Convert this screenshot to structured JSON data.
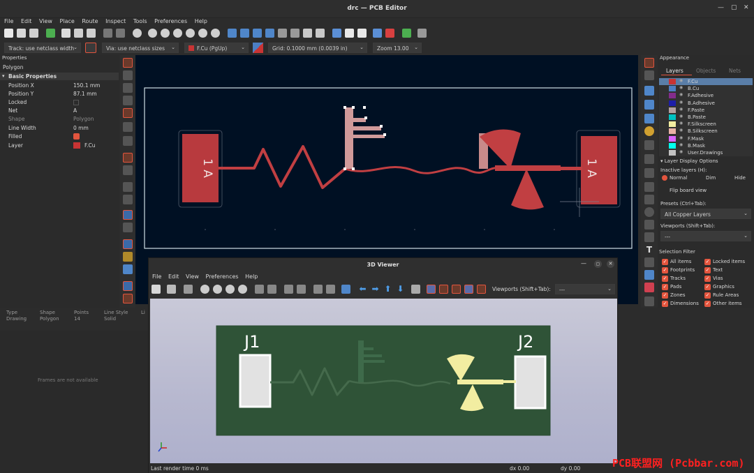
{
  "window": {
    "title": "drc — PCB Editor",
    "controls": [
      "—",
      "▢",
      "✕"
    ]
  },
  "menu": [
    "File",
    "Edit",
    "View",
    "Place",
    "Route",
    "Inspect",
    "Tools",
    "Preferences",
    "Help"
  ],
  "toolbar2": {
    "track": "Track: use netclass width",
    "via": "Via: use netclass sizes",
    "layer": "F.Cu (PgUp)",
    "grid": "Grid: 0.1000 mm (0.0039 in)",
    "zoom": "Zoom 13.00"
  },
  "properties": {
    "header": "Properties",
    "type": "Polygon",
    "section": "Basic Properties",
    "rows": [
      {
        "key": "Position X",
        "value": "150.1 mm"
      },
      {
        "key": "Position Y",
        "value": "87.1 mm"
      },
      {
        "key": "Locked",
        "value": ""
      },
      {
        "key": "Net",
        "value": "A"
      },
      {
        "key": "Shape",
        "value": "Polygon"
      },
      {
        "key": "Line Width",
        "value": "0 mm"
      },
      {
        "key": "Filled",
        "value": ""
      },
      {
        "key": "Layer",
        "value": "F.Cu"
      }
    ]
  },
  "canvas": {
    "pad_left_label": "1 A",
    "pad_right_label": "1 A"
  },
  "appearance": {
    "header": "Appearance",
    "tabs": [
      "Layers",
      "Objects",
      "Nets"
    ],
    "layers": [
      {
        "name": "F.Cu",
        "color": "#c83434"
      },
      {
        "name": "B.Cu",
        "color": "#4d7fc4"
      },
      {
        "name": "F.Adhesive",
        "color": "#842c8c"
      },
      {
        "name": "B.Adhesive",
        "color": "#1e1ea8"
      },
      {
        "name": "F.Paste",
        "color": "#b4a0a0"
      },
      {
        "name": "B.Paste",
        "color": "#00c2c2"
      },
      {
        "name": "F.Silkscreen",
        "color": "#f2eda1"
      },
      {
        "name": "B.Silkscreen",
        "color": "#e8b2a7"
      },
      {
        "name": "F.Mask",
        "color": "#d864ff"
      },
      {
        "name": "B.Mask",
        "color": "#02ffee"
      },
      {
        "name": "User.Drawings",
        "color": "#c2c2c2"
      }
    ],
    "display_options": "Layer Display Options",
    "inactive_label": "Inactive layers (H):",
    "inactive_options": [
      "Normal",
      "Dim",
      "Hide"
    ],
    "flip": "Flip board view",
    "presets_label": "Presets (Ctrl+Tab):",
    "presets_value": "All Copper Layers",
    "viewports_label": "Viewports (Shift+Tab):",
    "viewports_value": "---",
    "selection_filter": "Selection Filter",
    "filters": [
      "All items",
      "Locked items",
      "Footprints",
      "Text",
      "Tracks",
      "Vias",
      "Pads",
      "Graphics",
      "Zones",
      "Rule Areas",
      "Dimensions",
      "Other items"
    ]
  },
  "status": {
    "cols": [
      {
        "h": "Type",
        "v": "Drawing"
      },
      {
        "h": "Shape",
        "v": "Polygon"
      },
      {
        "h": "Points",
        "v": "14"
      },
      {
        "h": "Line Style",
        "v": "Solid"
      },
      {
        "h": "Li",
        "v": ""
      }
    ],
    "frames": "Frames are not available"
  },
  "viewer3d": {
    "title": "3D Viewer",
    "menu": [
      "File",
      "Edit",
      "View",
      "Preferences",
      "Help"
    ],
    "viewports_label": "Viewports (Shift+Tab):",
    "viewports_value": "---",
    "j1": "J1",
    "j2": "J2",
    "status": "Last render time 0 ms",
    "dx": "dx 0.00",
    "dy": "dy 0.00"
  },
  "watermark": "PCB联盟网 (Pcbbar.com)"
}
